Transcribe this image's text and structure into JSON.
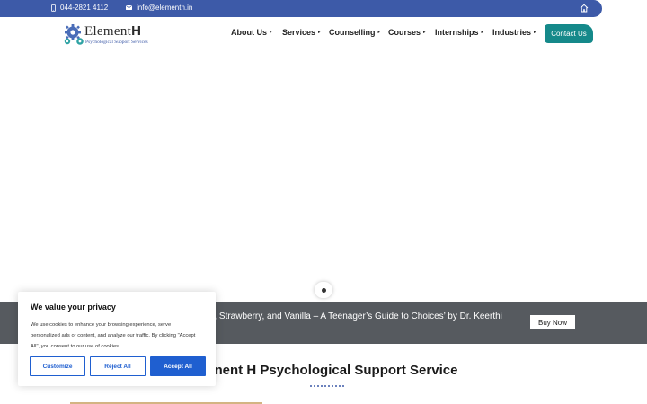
{
  "topbar": {
    "phone": "044-2821 4112",
    "email": "info@elementh.in",
    "phone_icon": "phone-icon",
    "email_icon": "mail-icon",
    "home_icon": "home-icon"
  },
  "logo": {
    "name_prefix": "Element",
    "name_suffix": "H",
    "tagline": "Psychological Support Services"
  },
  "nav": {
    "items": [
      {
        "label": "About Us"
      },
      {
        "label": "Services"
      },
      {
        "label": "Counselling"
      },
      {
        "label": "Courses"
      },
      {
        "label": "Internships"
      },
      {
        "label": "Industries"
      }
    ],
    "caret": "▸",
    "contact_label": "Contact Us"
  },
  "promo": {
    "text": "te, Strawberry, and Vanilla – A Teenager’s Guide to Choices’ by Dr. Keerthi",
    "buy_label": "Buy Now"
  },
  "section": {
    "heading": "ement H Psychological Support Service"
  },
  "cookie": {
    "title": "We value your privacy",
    "body": "We use cookies to enhance your browsing experience, serve personalized ads or content, and analyze our traffic. By clicking \"Accept All\", you consent to our use of cookies.",
    "customize": "Customize",
    "reject": "Reject All",
    "accept": "Accept All"
  },
  "colors": {
    "topbar": "#3d5aa8",
    "contact": "#15898a",
    "promo_bg": "#565a5f",
    "cookie_accent": "#1f5fd0"
  }
}
